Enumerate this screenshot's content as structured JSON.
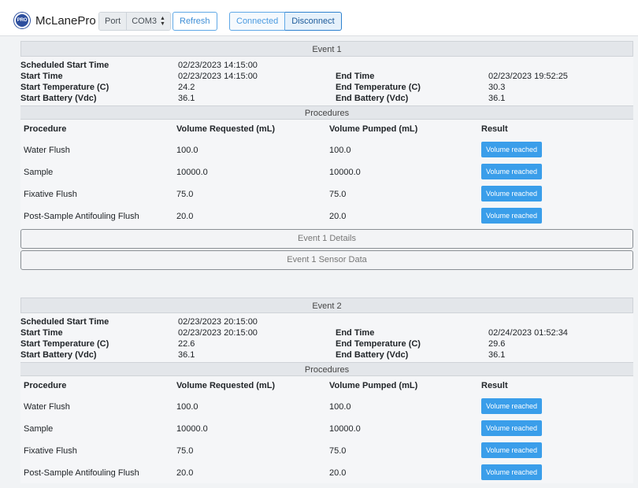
{
  "app": {
    "logo_text": "PRO",
    "name": "McLanePro"
  },
  "toolbar": {
    "port_label": "Port",
    "port_value": "COM3",
    "refresh_label": "Refresh",
    "connected_label": "Connected",
    "disconnect_label": "Disconnect"
  },
  "labels": {
    "scheduled_start_time": "Scheduled Start Time",
    "start_time": "Start Time",
    "end_time": "End Time",
    "start_temperature": "Start Temperature (C)",
    "end_temperature": "End Temperature (C)",
    "start_battery": "Start Battery (Vdc)",
    "end_battery": "End Battery (Vdc)",
    "procedures_title": "Procedures",
    "col_procedure": "Procedure",
    "col_volume_requested": "Volume Requested (mL)",
    "col_volume_pumped": "Volume Pumped (mL)",
    "col_result": "Result"
  },
  "events": [
    {
      "title": "Event 1",
      "scheduled_start_time": "02/23/2023 14:15:00",
      "start_time": "02/23/2023 14:15:00",
      "end_time": "02/23/2023 19:52:25",
      "start_temperature": "24.2",
      "end_temperature": "30.3",
      "start_battery": "36.1",
      "end_battery": "36.1",
      "procedures": [
        {
          "name": "Water Flush",
          "requested": "100.0",
          "pumped": "100.0",
          "result": "Volume reached"
        },
        {
          "name": "Sample",
          "requested": "10000.0",
          "pumped": "10000.0",
          "result": "Volume reached"
        },
        {
          "name": "Fixative Flush",
          "requested": "75.0",
          "pumped": "75.0",
          "result": "Volume reached"
        },
        {
          "name": "Post-Sample Antifouling Flush",
          "requested": "20.0",
          "pumped": "20.0",
          "result": "Volume reached"
        }
      ],
      "details_label": "Event 1 Details",
      "sensor_label": "Event 1 Sensor Data"
    },
    {
      "title": "Event 2",
      "scheduled_start_time": "02/23/2023 20:15:00",
      "start_time": "02/23/2023 20:15:00",
      "end_time": "02/24/2023 01:52:34",
      "start_temperature": "22.6",
      "end_temperature": "29.6",
      "start_battery": "36.1",
      "end_battery": "36.1",
      "procedures": [
        {
          "name": "Water Flush",
          "requested": "100.0",
          "pumped": "100.0",
          "result": "Volume reached"
        },
        {
          "name": "Sample",
          "requested": "10000.0",
          "pumped": "10000.0",
          "result": "Volume reached"
        },
        {
          "name": "Fixative Flush",
          "requested": "75.0",
          "pumped": "75.0",
          "result": "Volume reached"
        },
        {
          "name": "Post-Sample Antifouling Flush",
          "requested": "20.0",
          "pumped": "20.0",
          "result": "Volume reached"
        }
      ]
    }
  ],
  "colors": {
    "accent": "#3a9eea",
    "brand": "#2d4f9e"
  }
}
